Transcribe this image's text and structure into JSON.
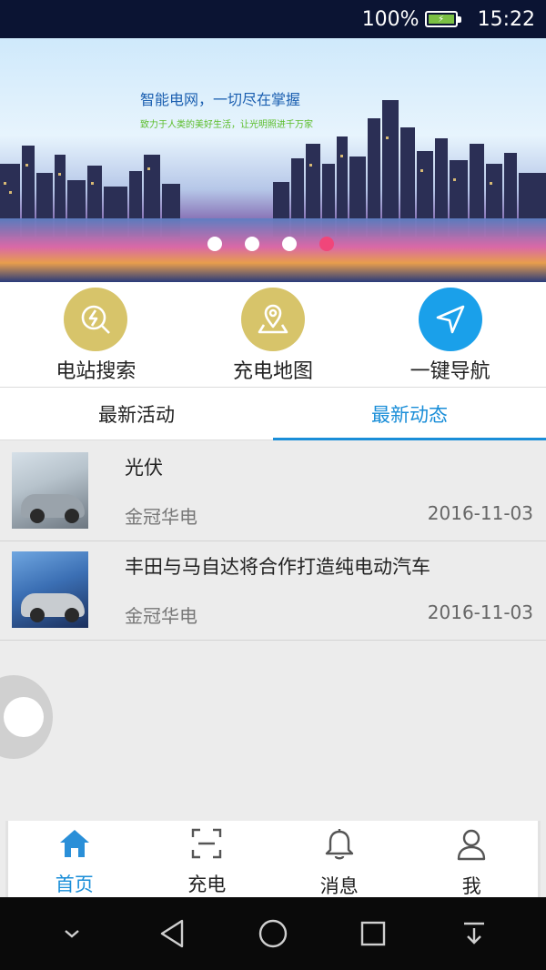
{
  "status_bar": {
    "battery_percent": "100%",
    "time": "15:22",
    "battery_level": 1.0,
    "battery_color": "#7bc044"
  },
  "banner": {
    "title": "智能电网，一切尽在掌握",
    "subtitle": "致力于人类的美好生活，让光明照进千万家",
    "slide_count": 4,
    "active_slide": 4,
    "active_dot_color": "#f0467a"
  },
  "quick_actions": [
    {
      "label": "电站搜索",
      "icon": "search-bolt-icon",
      "color": "#d7c46a"
    },
    {
      "label": "充电地图",
      "icon": "map-pin-icon",
      "color": "#d7c46a"
    },
    {
      "label": "一键导航",
      "icon": "navigation-arrow-icon",
      "color": "#1aa0ea"
    }
  ],
  "tabs": [
    {
      "label": "最新活动",
      "active": false
    },
    {
      "label": "最新动态",
      "active": true
    }
  ],
  "news": [
    {
      "title": "光伏",
      "source": "金冠华电",
      "date": "2016-11-03"
    },
    {
      "title": "丰田与马自达将合作打造纯电动汽车",
      "source": "金冠华电",
      "date": "2016-11-03"
    }
  ],
  "bottom_nav": [
    {
      "label": "首页",
      "icon": "home-icon",
      "active": true
    },
    {
      "label": "充电",
      "icon": "scan-icon",
      "active": false
    },
    {
      "label": "消息",
      "icon": "bell-icon",
      "active": false
    },
    {
      "label": "我",
      "icon": "user-icon",
      "active": false
    }
  ],
  "accent_color": "#1a8ed8"
}
